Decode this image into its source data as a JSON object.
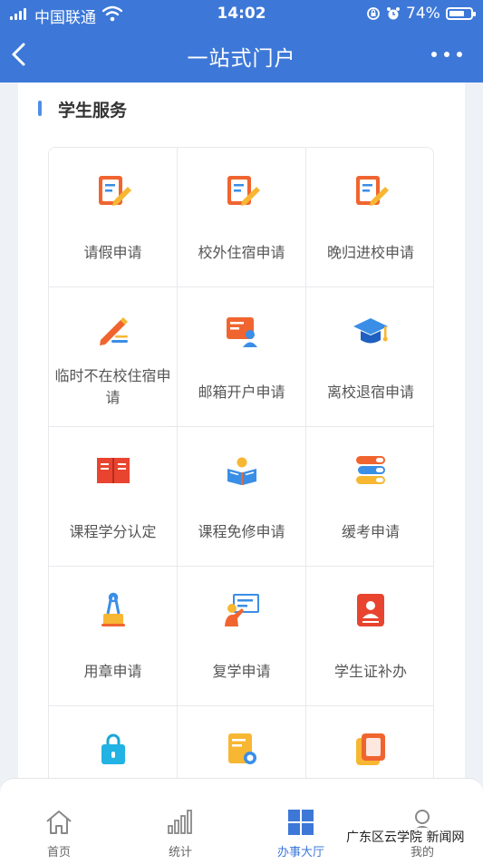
{
  "status_bar": {
    "carrier": "中国联通",
    "time": "14:02",
    "battery": "74%",
    "battery_level": 0.74
  },
  "header": {
    "title": "一站式门户",
    "back_icon": "chevron-left-icon",
    "more_icon": "more-dots-icon"
  },
  "section": {
    "title": "学生服务"
  },
  "services": [
    {
      "label": "请假申请",
      "icon": "form-edit-icon"
    },
    {
      "label": "校外住宿申请",
      "icon": "form-edit-icon"
    },
    {
      "label": "晚归进校申请",
      "icon": "form-edit-icon"
    },
    {
      "label": "临时不在校住宿申请",
      "icon": "pencil-icon"
    },
    {
      "label": "邮箱开户申请",
      "icon": "account-card-icon"
    },
    {
      "label": "离校退宿申请",
      "icon": "graduation-cap-icon"
    },
    {
      "label": "课程学分认定",
      "icon": "book-icon"
    },
    {
      "label": "课程免修申请",
      "icon": "reading-icon"
    },
    {
      "label": "缓考申请",
      "icon": "books-stack-icon"
    },
    {
      "label": "用章申请",
      "icon": "stamp-clip-icon"
    },
    {
      "label": "复学申请",
      "icon": "teacher-board-icon"
    },
    {
      "label": "学生证补办",
      "icon": "student-id-icon"
    },
    {
      "label": "",
      "icon": "lock-bag-icon"
    },
    {
      "label": "",
      "icon": "document-search-icon"
    },
    {
      "label": "",
      "icon": "copy-icon"
    }
  ],
  "tabs": [
    {
      "label": "首页",
      "icon": "home-icon",
      "active": false
    },
    {
      "label": "统计",
      "icon": "bar-chart-icon",
      "active": false
    },
    {
      "label": "办事大厅",
      "icon": "grid-icon",
      "active": true
    },
    {
      "label": "我的",
      "icon": "user-icon",
      "active": false
    }
  ],
  "colors": {
    "primary": "#3d78d8",
    "accent_orange": "#f0652f",
    "accent_yellow": "#f7b733",
    "accent_blue": "#3a8ee6"
  },
  "watermark": "广东区云学院 新闻网"
}
